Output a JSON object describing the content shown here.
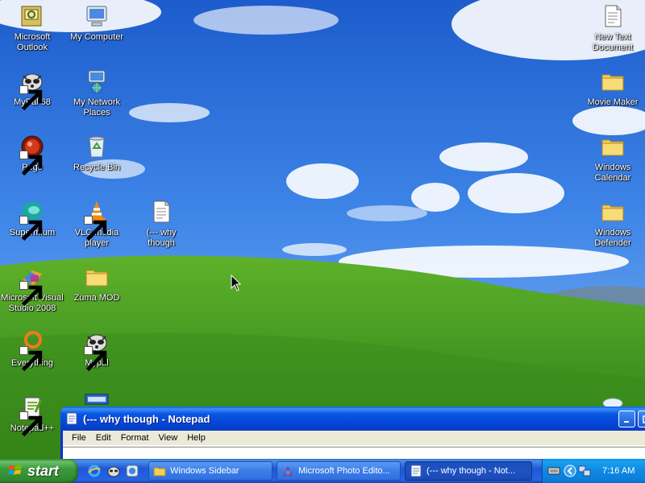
{
  "desktop": {
    "icons": {
      "outlook": "Microsoft\nOutlook",
      "mycomputer": "My Computer",
      "newtext": "New Text\nDocument",
      "mypal68": "MyPal 68",
      "network": "My Network\nPlaces",
      "moviemaker": "Movie Maker",
      "pego": "Pego",
      "recycle": "Recycle Bin",
      "wincalendar": "Windows\nCalendar",
      "supermium": "Supermium",
      "vlc": "VLC media\nplayer",
      "whythough": "(--- why\nthough",
      "windefender": "Windows\nDefender",
      "msvs": "Microsoft Visual\nStudio 2008",
      "zuma": "Zuma MOD",
      "everything": "Everything",
      "mypal": "Mypal",
      "notepadpp": "Notepad++"
    }
  },
  "notepad": {
    "title": "(--- why though - Notepad",
    "menus": [
      "File",
      "Edit",
      "Format",
      "View",
      "Help"
    ]
  },
  "taskbar": {
    "start_label": "start",
    "tasks": [
      {
        "label": "Windows Sidebar"
      },
      {
        "label": "Microsoft Photo Edito..."
      },
      {
        "label": "(--- why though - Not..."
      }
    ],
    "clock": "7:16 AM"
  },
  "colors": {
    "sky": "#1f5fd0",
    "grass": "#4c9a1e",
    "taskbar": "#245edb",
    "start": "#3c9a3c",
    "tray": "#0f8be4"
  }
}
